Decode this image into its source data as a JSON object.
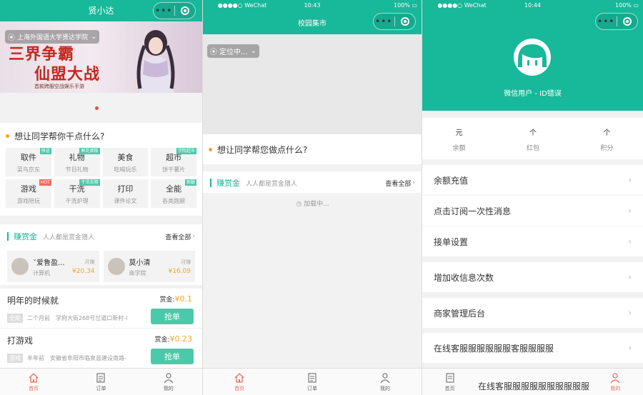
{
  "screen1": {
    "nav_title": "贤小达",
    "location": "上海外国语大学贤达学院",
    "banner": {
      "line1": "三界争霸",
      "line2": "仙盟大战",
      "tagline": "首款跨服空战娱乐手游"
    },
    "question": "想让同学帮你干点什么?",
    "services": [
      {
        "name": "取件",
        "sub": "菜鸟京东",
        "badge": "快送",
        "hot": false
      },
      {
        "name": "礼物",
        "sub": "节日礼物",
        "badge": "鲜花蛋糕",
        "hot": false
      },
      {
        "name": "美食",
        "sub": "吃喝玩乐",
        "badge": "",
        "hot": false
      },
      {
        "name": "超市",
        "sub": "饼干薯片",
        "badge": "学院超市",
        "hot": false
      },
      {
        "name": "游戏",
        "sub": "游戏陪玩",
        "badge": "HOT",
        "hot": true
      },
      {
        "name": "干洗",
        "sub": "干洗护理",
        "badge": "干洗衣物",
        "hot": false
      },
      {
        "name": "打印",
        "sub": "课件论文",
        "badge": "",
        "hot": false
      },
      {
        "name": "全能",
        "sub": "各类跑腿",
        "badge": "跑腿",
        "hot": false
      }
    ],
    "reward_title": "赚赏金",
    "reward_sub": "人人都是赏金猎人",
    "view_all": "查看全部",
    "hunters": [
      {
        "name": "ˇ爱鲁盈...",
        "school": "计算机",
        "period": "月赚",
        "amount": "¥20.34"
      },
      {
        "name": "莫小清",
        "school": "商学院",
        "period": "月赚",
        "amount": "¥16.09"
      }
    ],
    "orders": [
      {
        "title": "明年的时候就",
        "reward_label": "赏金:",
        "reward": "¥0.1",
        "tag": "全能",
        "time": "二个月前",
        "addr": "学府大街268号岔道口新村-l",
        "btn": "抢单"
      },
      {
        "title": "打游戏",
        "reward_label": "赏金:",
        "reward": "¥0.23",
        "tag": "游戏",
        "time": "半年前",
        "addr": "安徽省阜阳市临泉县建设南路-",
        "btn": "抢单"
      }
    ],
    "tabs": [
      "首页",
      "订单",
      "我的"
    ]
  },
  "screen2": {
    "status": {
      "carrier": "WeChat",
      "time": "10:43",
      "battery": "100%"
    },
    "nav_title": "校园集市",
    "location": "定位中...",
    "question": "想让同学帮您做点什么?",
    "reward_title": "赚赏金",
    "reward_sub": "人人都是赏金猎人",
    "view_all": "查看全部",
    "loading": "加载中...",
    "tabs": [
      "首页",
      "订单",
      "我的"
    ]
  },
  "screen3": {
    "status": {
      "carrier": "WeChat",
      "time": "10:44",
      "battery": "100%"
    },
    "username": "微信用户 - ID错误",
    "stats": [
      {
        "unit": "元",
        "label": "余额"
      },
      {
        "unit": "个",
        "label": "红包"
      },
      {
        "unit": "个",
        "label": "积分"
      }
    ],
    "menu": [
      "余额充值",
      "点击订阅一次性消息",
      "接单设置",
      "增加收信息次数",
      "商家管理后台",
      "在线客服服服服服服客服服服服"
    ],
    "overlay_text": "在线客服服服服服服服服服服",
    "tabs": [
      "首页",
      "我的"
    ]
  },
  "colors": {
    "primary": "#18b89a",
    "accent": "#f26b5e",
    "reward": "#f5a623"
  }
}
